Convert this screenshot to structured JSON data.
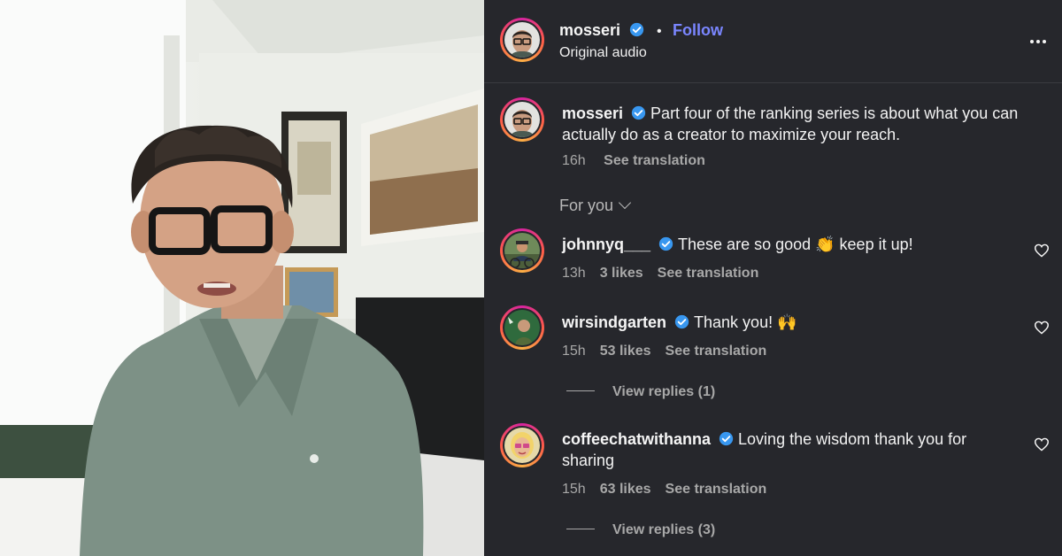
{
  "post": {
    "author": "mosseri",
    "verified": true,
    "separator": "•",
    "follow_label": "Follow",
    "audio": "Original audio"
  },
  "caption": {
    "author": "mosseri",
    "text": "Part four of the ranking series is about what you can actually do as a creator to maximize your reach.",
    "time": "16h",
    "translate_label": "See translation"
  },
  "sort": {
    "label": "For you"
  },
  "comments": [
    {
      "author": "johnnyq___",
      "text": "These are so good 👏 keep it up!",
      "time": "13h",
      "likes": "3 likes",
      "translate_label": "See translation"
    },
    {
      "author": "wirsindgarten",
      "text": "Thank you! 🙌",
      "time": "15h",
      "likes": "53 likes",
      "translate_label": "See translation",
      "replies_label": "View replies (1)"
    },
    {
      "author": "coffeechatwithanna",
      "text": "Loving the wisdom thank you for sharing",
      "time": "15h",
      "likes": "63 likes",
      "translate_label": "See translation",
      "replies_label": "View replies (3)"
    }
  ],
  "icons": {
    "verified": "verified-badge-icon",
    "more": "more-options-icon",
    "like": "heart-icon",
    "sort": "chevron-down-icon"
  },
  "colors": {
    "panel_bg": "#26272c",
    "accent_link": "#7a86ff",
    "verified_blue": "#3897f0",
    "muted_text": "#a8a8a8"
  }
}
